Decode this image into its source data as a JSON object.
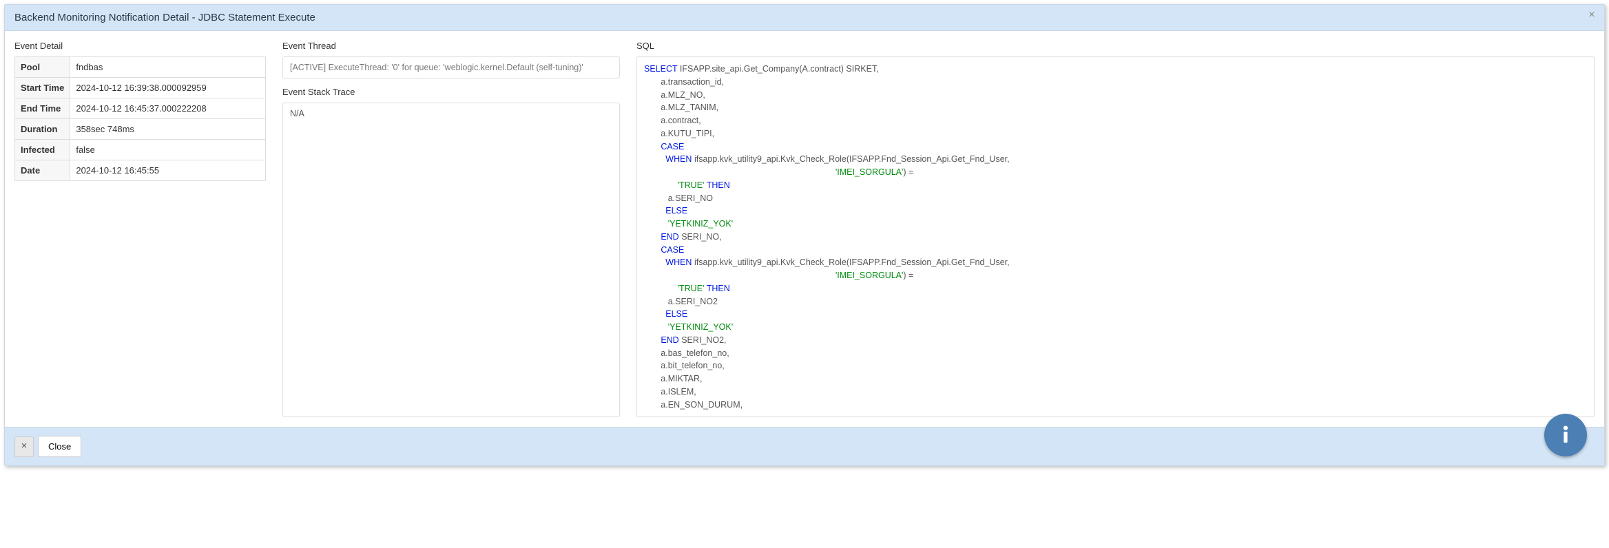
{
  "dialog": {
    "title": "Backend Monitoring Notification Detail - JDBC Statement Execute",
    "close_glyph": "×"
  },
  "sections": {
    "event_detail": "Event Detail",
    "event_thread": "Event Thread",
    "event_stack_trace": "Event Stack Trace",
    "sql": "SQL"
  },
  "detail": {
    "rows": [
      {
        "label": "Pool",
        "value": "fndbas"
      },
      {
        "label": "Start Time",
        "value": "2024-10-12 16:39:38.000092959"
      },
      {
        "label": "End Time",
        "value": "2024-10-12 16:45:37.000222208"
      },
      {
        "label": "Duration",
        "value": "358sec 748ms"
      },
      {
        "label": "Infected",
        "value": "false"
      },
      {
        "label": "Date",
        "value": "2024-10-12 16:45:55"
      }
    ]
  },
  "thread": {
    "prefix": "[ACTIVE] ExecuteThread: ",
    "num": "'0'",
    "for": " for ",
    "queue_lbl": "queue: ",
    "queue_val": "'weblogic.kernel.Default (self-tuning)'"
  },
  "stack_trace": "N/A",
  "sql": {
    "lines": [
      [
        [
          "k",
          "SELECT"
        ],
        [
          "t",
          " IFSAPP.site_api.Get_Company(A.contract) SIRKET,"
        ]
      ],
      [
        [
          "t",
          "       a.transaction_id,"
        ]
      ],
      [
        [
          "t",
          "       a.MLZ_NO,"
        ]
      ],
      [
        [
          "t",
          "       a.MLZ_TANIM,"
        ]
      ],
      [
        [
          "t",
          "       a.contract,"
        ]
      ],
      [
        [
          "t",
          "       a.KUTU_TIPI,"
        ]
      ],
      [
        [
          "t",
          "       "
        ],
        [
          "k",
          "CASE"
        ]
      ],
      [
        [
          "t",
          "         "
        ],
        [
          "k",
          "WHEN"
        ],
        [
          "t",
          " ifsapp.kvk_utility9_api.Kvk_Check_Role(IFSAPP.Fnd_Session_Api.Get_Fnd_User,"
        ]
      ],
      [
        [
          "t",
          "                                                                                "
        ],
        [
          "s",
          "'IMEI_SORGULA'"
        ],
        [
          "t",
          ") ="
        ]
      ],
      [
        [
          "t",
          "              "
        ],
        [
          "s",
          "'TRUE'"
        ],
        [
          "t",
          " "
        ],
        [
          "k",
          "THEN"
        ]
      ],
      [
        [
          "t",
          "          a.SERI_NO"
        ]
      ],
      [
        [
          "t",
          "         "
        ],
        [
          "k",
          "ELSE"
        ]
      ],
      [
        [
          "t",
          "          "
        ],
        [
          "s",
          "'YETKINIZ_YOK'"
        ]
      ],
      [
        [
          "t",
          "       "
        ],
        [
          "k",
          "END"
        ],
        [
          "t",
          " SERI_NO,"
        ]
      ],
      [
        [
          "t",
          "       "
        ],
        [
          "k",
          "CASE"
        ]
      ],
      [
        [
          "t",
          "         "
        ],
        [
          "k",
          "WHEN"
        ],
        [
          "t",
          " ifsapp.kvk_utility9_api.Kvk_Check_Role(IFSAPP.Fnd_Session_Api.Get_Fnd_User,"
        ]
      ],
      [
        [
          "t",
          "                                                                                "
        ],
        [
          "s",
          "'IMEI_SORGULA'"
        ],
        [
          "t",
          ") ="
        ]
      ],
      [
        [
          "t",
          "              "
        ],
        [
          "s",
          "'TRUE'"
        ],
        [
          "t",
          " "
        ],
        [
          "k",
          "THEN"
        ]
      ],
      [
        [
          "t",
          "          a.SERI_NO2"
        ]
      ],
      [
        [
          "t",
          "         "
        ],
        [
          "k",
          "ELSE"
        ]
      ],
      [
        [
          "t",
          "          "
        ],
        [
          "s",
          "'YETKINIZ_YOK'"
        ]
      ],
      [
        [
          "t",
          "       "
        ],
        [
          "k",
          "END"
        ],
        [
          "t",
          " SERI_NO2,"
        ]
      ],
      [
        [
          "t",
          "       a.bas_telefon_no,"
        ]
      ],
      [
        [
          "t",
          "       a.bit_telefon_no,"
        ]
      ],
      [
        [
          "t",
          "       a.MIKTAR,"
        ]
      ],
      [
        [
          "t",
          "       a.ISLEM,"
        ]
      ],
      [
        [
          "t",
          "       a.EN_SON_DURUM,"
        ]
      ]
    ]
  },
  "footer": {
    "x_glyph": "×",
    "close_label": "Close"
  }
}
